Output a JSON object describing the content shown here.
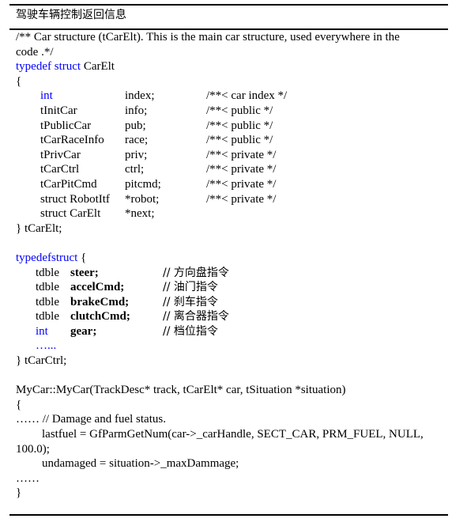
{
  "caption": "驾驶车辆控制返回信息",
  "code": {
    "comment_line1": "/** Car structure (tCarElt). This is the main car structure, used everywhere in the",
    "comment_line2": "code .*/",
    "typedef_kw": "typedef",
    "struct_kw": "struct",
    "struct_name": " CarElt",
    "open_brace": "{",
    "car_fields": [
      {
        "type": "int",
        "type_is_keyword": true,
        "name": "index;",
        "comment": "/**< car index */"
      },
      {
        "type": "tInitCar",
        "type_is_keyword": false,
        "name": "info;",
        "comment": "/**< public */"
      },
      {
        "type": "tPublicCar",
        "type_is_keyword": false,
        "name": "pub;",
        "comment": "/**< public */"
      },
      {
        "type": "tCarRaceInfo",
        "type_is_keyword": false,
        "name": "race;",
        "comment": "/**< public */"
      },
      {
        "type": "tPrivCar",
        "type_is_keyword": false,
        "name": "priv;",
        "comment": "/**< private */"
      },
      {
        "type": "tCarCtrl",
        "type_is_keyword": false,
        "name": "ctrl;",
        "comment": "/**< private */"
      },
      {
        "type": "tCarPitCmd",
        "type_is_keyword": false,
        "name": "pitcmd;",
        "comment": "/**< private */"
      },
      {
        "type": "struct RobotItf",
        "type_is_keyword": false,
        "name": "*robot;",
        "comment": "/**< private */"
      },
      {
        "type": "struct CarElt",
        "type_is_keyword": false,
        "name": "*next;",
        "comment": ""
      }
    ],
    "car_close": "} tCarElt;",
    "typedefstruct_kw": "typedefstruct",
    "ctrl_open": " {",
    "ctrl_fields": [
      {
        "type": "tdble",
        "type_is_keyword": false,
        "name": "steer;",
        "comment": "//  方向盘指令"
      },
      {
        "type": "tdble",
        "type_is_keyword": false,
        "name": "accelCmd;",
        "comment": "//  油门指令"
      },
      {
        "type": "tdble",
        "type_is_keyword": false,
        "name": "brakeCmd;",
        "comment": "//  刹车指令"
      },
      {
        "type": "tdble",
        "type_is_keyword": false,
        "name": "clutchCmd;",
        "comment": "//  离合器指令"
      },
      {
        "type": "int",
        "type_is_keyword": true,
        "name": "gear;",
        "comment": "//  档位指令"
      }
    ],
    "ctrl_ellipsis": "…...",
    "ctrl_close": "} tCarCtrl;",
    "ctor_signature": "MyCar::MyCar(TrackDesc* track, tCarElt* car, tSituation *situation)",
    "ctor_open": "{",
    "ctor_comment": "…… // Damage and fuel status.",
    "ctor_line_fuel1": "lastfuel = GfParmGetNum(car->_carHandle, SECT_CAR, PRM_FUEL, NULL,",
    "ctor_line_fuel2": "100.0);",
    "ctor_line_damage": "undamaged = situation->_maxDammage;",
    "ctor_ellipsis": "……",
    "ctor_close": "}"
  }
}
